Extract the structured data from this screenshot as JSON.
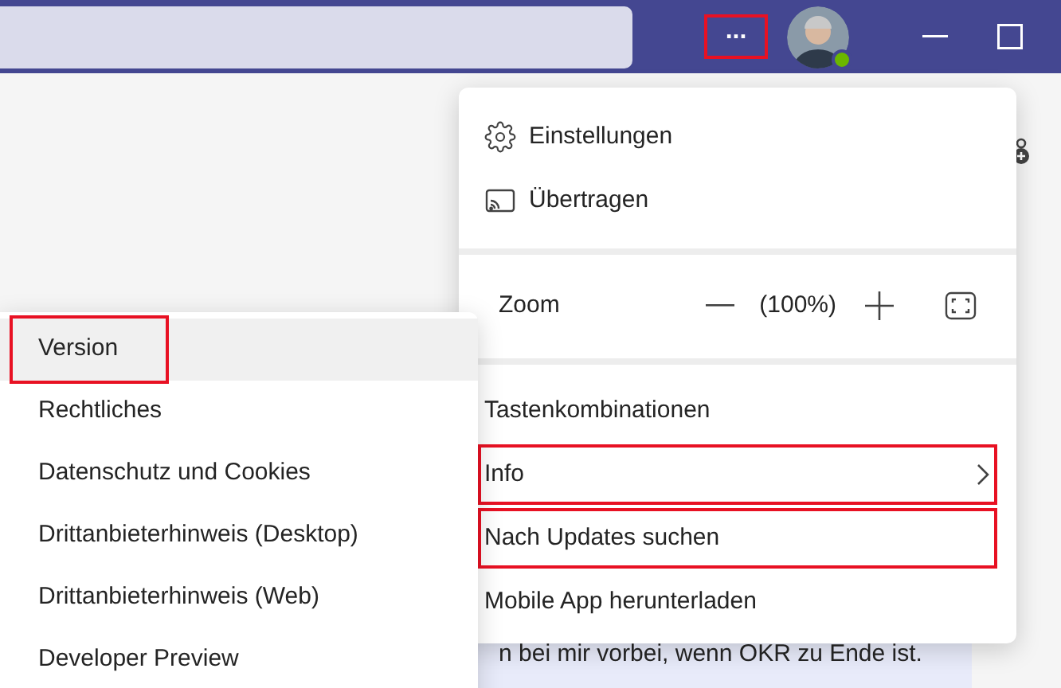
{
  "title_bar": {
    "more_button": {
      "label": "...",
      "highlighted": true
    }
  },
  "main_menu": {
    "items": [
      {
        "kind": "settings",
        "label": "Einstellungen",
        "highlighted": false,
        "submenu": false
      },
      {
        "kind": "cast",
        "label": "Übertragen",
        "highlighted": false,
        "submenu": false
      },
      {
        "kind": "divider"
      },
      {
        "kind": "zoom",
        "label": "Zoom",
        "value": "(100%)"
      },
      {
        "kind": "divider"
      },
      {
        "kind": "item",
        "label": "Tastenkombinationen",
        "highlighted": false,
        "submenu": false
      },
      {
        "kind": "item",
        "label": "Info",
        "highlighted": true,
        "submenu": true
      },
      {
        "kind": "item",
        "label": "Nach Updates suchen",
        "highlighted": true,
        "submenu": false
      },
      {
        "kind": "item",
        "label": "Mobile App herunterladen",
        "highlighted": false,
        "submenu": false
      }
    ]
  },
  "info_submenu": {
    "items": [
      {
        "label": "Version",
        "selected": true,
        "highlighted": true
      },
      {
        "label": "Rechtliches",
        "selected": false,
        "highlighted": false
      },
      {
        "label": "Datenschutz und Cookies",
        "selected": false,
        "highlighted": false
      },
      {
        "label": "Drittanbieterhinweis (Desktop)",
        "selected": false,
        "highlighted": false
      },
      {
        "label": "Drittanbieterhinweis (Web)",
        "selected": false,
        "highlighted": false
      },
      {
        "label": "Developer Preview",
        "selected": false,
        "highlighted": false
      }
    ]
  },
  "chat": {
    "message": "n bei mir vorbei, wenn OKR zu Ende ist."
  }
}
